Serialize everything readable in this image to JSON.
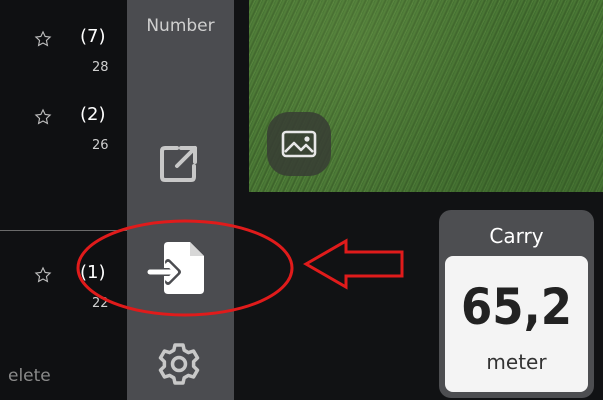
{
  "list": {
    "items": [
      {
        "count": "(7)",
        "sub": "28"
      },
      {
        "count": "(2)",
        "sub": "26"
      },
      {
        "count": "(1)",
        "sub": "22"
      }
    ],
    "delete_label": "elete"
  },
  "rail": {
    "title": "Number",
    "icons": [
      "share-icon",
      "import-file-icon",
      "settings-gear-icon"
    ]
  },
  "photo": {
    "button_icon": "image-icon"
  },
  "carry": {
    "label": "Carry",
    "value": "65,2",
    "unit": "meter"
  },
  "colors": {
    "accent_red": "#e01b1b",
    "rail": "#4b4c50",
    "card": "#4d4e51"
  }
}
